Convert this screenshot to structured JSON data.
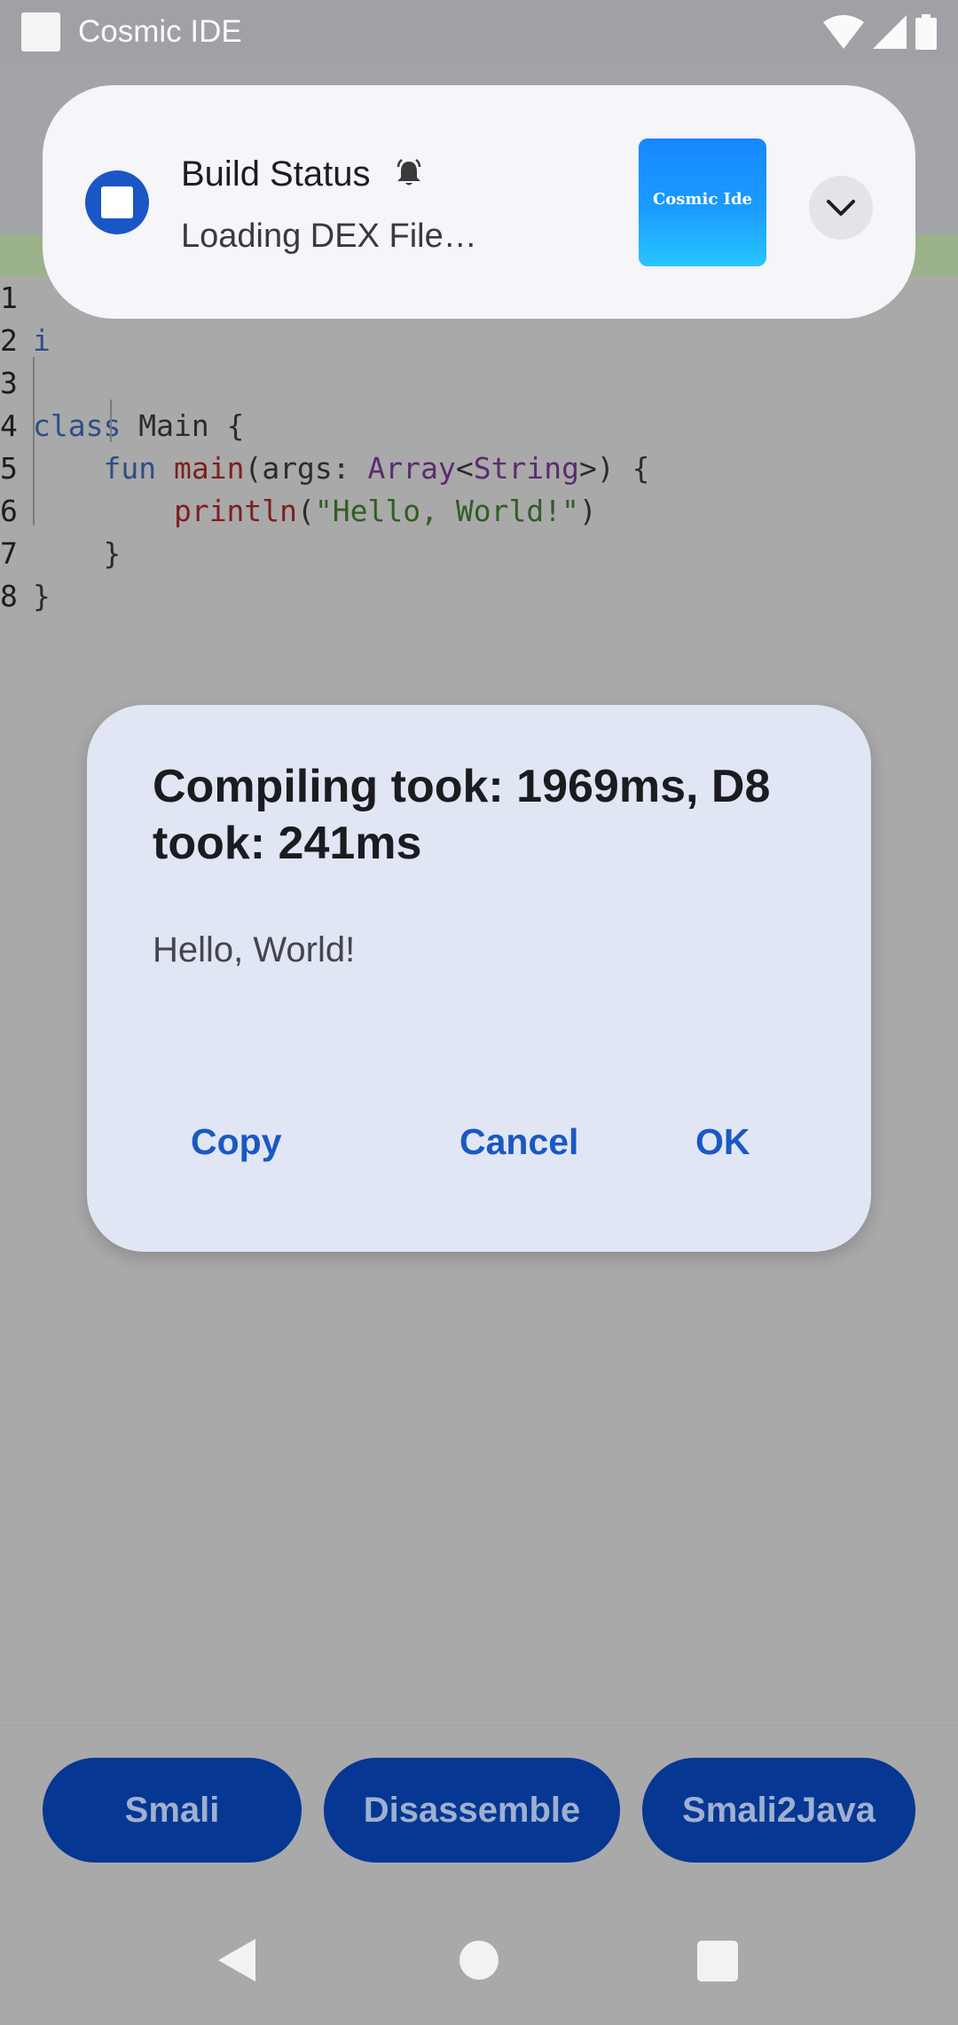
{
  "status_bar": {
    "app_title": "Cosmic IDE"
  },
  "editor": {
    "lines": [
      {
        "n": "1",
        "text": "i"
      },
      {
        "n": "2",
        "text": ""
      },
      {
        "n": "3",
        "kw": "class",
        "rest": " Main {"
      },
      {
        "n": "4",
        "indent": "    ",
        "kw": "fun",
        "fn": "main",
        "p1": "(args: ",
        "ty1": "Array",
        "lt": "<",
        "ty2": "String",
        "rest": ">) {"
      },
      {
        "n": "5",
        "indent": "        ",
        "fn": "println",
        "p1": "(",
        "str": "\"Hello, World!\"",
        "rest": ")"
      },
      {
        "n": "6",
        "indent": "    ",
        "rest": "}"
      },
      {
        "n": "7",
        "rest": "}"
      },
      {
        "n": "8",
        "text": ""
      }
    ]
  },
  "notification": {
    "title": "Build Status",
    "text": "Loading DEX File…",
    "thumb_label": "Cosmic Ide"
  },
  "dialog": {
    "title": "Compiling took: 1969ms, D8 took: 241ms",
    "message": "Hello, World!",
    "copy_label": "Copy",
    "cancel_label": "Cancel",
    "ok_label": "OK"
  },
  "bottom_buttons": {
    "smali": "Smali",
    "disassemble": "Disassemble",
    "smali2java": "Smali2Java"
  },
  "colors": {
    "accent": "#1b58c2",
    "pill_bg": "#063793",
    "dialog_bg": "#e0e6f4"
  }
}
